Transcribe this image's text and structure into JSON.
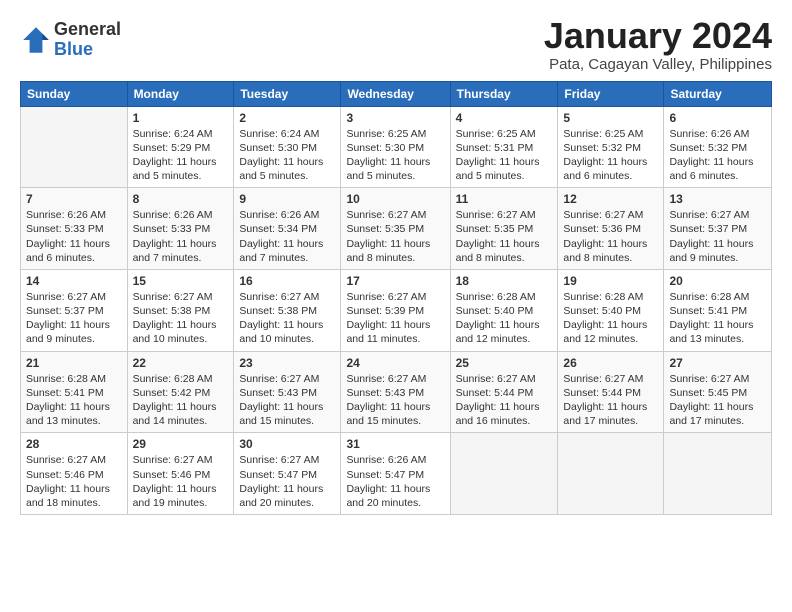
{
  "logo": {
    "general": "General",
    "blue": "Blue"
  },
  "title": "January 2024",
  "subtitle": "Pata, Cagayan Valley, Philippines",
  "days_of_week": [
    "Sunday",
    "Monday",
    "Tuesday",
    "Wednesday",
    "Thursday",
    "Friday",
    "Saturday"
  ],
  "weeks": [
    [
      {
        "num": "",
        "info": ""
      },
      {
        "num": "1",
        "info": "Sunrise: 6:24 AM\nSunset: 5:29 PM\nDaylight: 11 hours\nand 5 minutes."
      },
      {
        "num": "2",
        "info": "Sunrise: 6:24 AM\nSunset: 5:30 PM\nDaylight: 11 hours\nand 5 minutes."
      },
      {
        "num": "3",
        "info": "Sunrise: 6:25 AM\nSunset: 5:30 PM\nDaylight: 11 hours\nand 5 minutes."
      },
      {
        "num": "4",
        "info": "Sunrise: 6:25 AM\nSunset: 5:31 PM\nDaylight: 11 hours\nand 5 minutes."
      },
      {
        "num": "5",
        "info": "Sunrise: 6:25 AM\nSunset: 5:32 PM\nDaylight: 11 hours\nand 6 minutes."
      },
      {
        "num": "6",
        "info": "Sunrise: 6:26 AM\nSunset: 5:32 PM\nDaylight: 11 hours\nand 6 minutes."
      }
    ],
    [
      {
        "num": "7",
        "info": "Sunrise: 6:26 AM\nSunset: 5:33 PM\nDaylight: 11 hours\nand 6 minutes."
      },
      {
        "num": "8",
        "info": "Sunrise: 6:26 AM\nSunset: 5:33 PM\nDaylight: 11 hours\nand 7 minutes."
      },
      {
        "num": "9",
        "info": "Sunrise: 6:26 AM\nSunset: 5:34 PM\nDaylight: 11 hours\nand 7 minutes."
      },
      {
        "num": "10",
        "info": "Sunrise: 6:27 AM\nSunset: 5:35 PM\nDaylight: 11 hours\nand 8 minutes."
      },
      {
        "num": "11",
        "info": "Sunrise: 6:27 AM\nSunset: 5:35 PM\nDaylight: 11 hours\nand 8 minutes."
      },
      {
        "num": "12",
        "info": "Sunrise: 6:27 AM\nSunset: 5:36 PM\nDaylight: 11 hours\nand 8 minutes."
      },
      {
        "num": "13",
        "info": "Sunrise: 6:27 AM\nSunset: 5:37 PM\nDaylight: 11 hours\nand 9 minutes."
      }
    ],
    [
      {
        "num": "14",
        "info": "Sunrise: 6:27 AM\nSunset: 5:37 PM\nDaylight: 11 hours\nand 9 minutes."
      },
      {
        "num": "15",
        "info": "Sunrise: 6:27 AM\nSunset: 5:38 PM\nDaylight: 11 hours\nand 10 minutes."
      },
      {
        "num": "16",
        "info": "Sunrise: 6:27 AM\nSunset: 5:38 PM\nDaylight: 11 hours\nand 10 minutes."
      },
      {
        "num": "17",
        "info": "Sunrise: 6:27 AM\nSunset: 5:39 PM\nDaylight: 11 hours\nand 11 minutes."
      },
      {
        "num": "18",
        "info": "Sunrise: 6:28 AM\nSunset: 5:40 PM\nDaylight: 11 hours\nand 12 minutes."
      },
      {
        "num": "19",
        "info": "Sunrise: 6:28 AM\nSunset: 5:40 PM\nDaylight: 11 hours\nand 12 minutes."
      },
      {
        "num": "20",
        "info": "Sunrise: 6:28 AM\nSunset: 5:41 PM\nDaylight: 11 hours\nand 13 minutes."
      }
    ],
    [
      {
        "num": "21",
        "info": "Sunrise: 6:28 AM\nSunset: 5:41 PM\nDaylight: 11 hours\nand 13 minutes."
      },
      {
        "num": "22",
        "info": "Sunrise: 6:28 AM\nSunset: 5:42 PM\nDaylight: 11 hours\nand 14 minutes."
      },
      {
        "num": "23",
        "info": "Sunrise: 6:27 AM\nSunset: 5:43 PM\nDaylight: 11 hours\nand 15 minutes."
      },
      {
        "num": "24",
        "info": "Sunrise: 6:27 AM\nSunset: 5:43 PM\nDaylight: 11 hours\nand 15 minutes."
      },
      {
        "num": "25",
        "info": "Sunrise: 6:27 AM\nSunset: 5:44 PM\nDaylight: 11 hours\nand 16 minutes."
      },
      {
        "num": "26",
        "info": "Sunrise: 6:27 AM\nSunset: 5:44 PM\nDaylight: 11 hours\nand 17 minutes."
      },
      {
        "num": "27",
        "info": "Sunrise: 6:27 AM\nSunset: 5:45 PM\nDaylight: 11 hours\nand 17 minutes."
      }
    ],
    [
      {
        "num": "28",
        "info": "Sunrise: 6:27 AM\nSunset: 5:46 PM\nDaylight: 11 hours\nand 18 minutes."
      },
      {
        "num": "29",
        "info": "Sunrise: 6:27 AM\nSunset: 5:46 PM\nDaylight: 11 hours\nand 19 minutes."
      },
      {
        "num": "30",
        "info": "Sunrise: 6:27 AM\nSunset: 5:47 PM\nDaylight: 11 hours\nand 20 minutes."
      },
      {
        "num": "31",
        "info": "Sunrise: 6:26 AM\nSunset: 5:47 PM\nDaylight: 11 hours\nand 20 minutes."
      },
      {
        "num": "",
        "info": ""
      },
      {
        "num": "",
        "info": ""
      },
      {
        "num": "",
        "info": ""
      }
    ]
  ]
}
